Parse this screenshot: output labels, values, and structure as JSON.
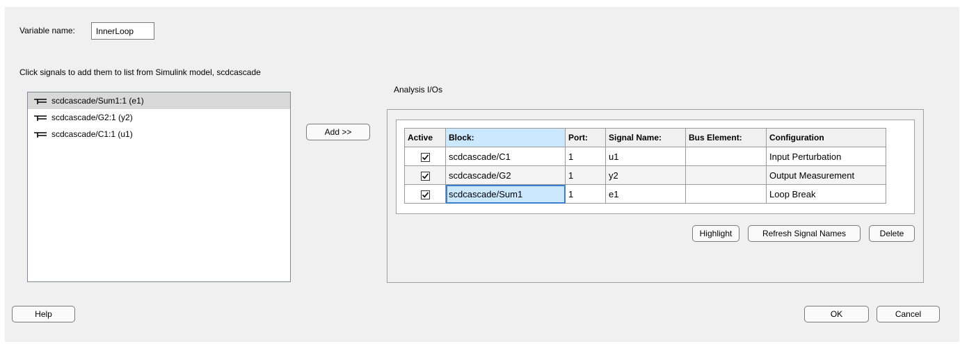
{
  "variable": {
    "label": "Variable name:",
    "value": "InnerLoop"
  },
  "instructions": "Click signals to add them to list from Simulink model, scdcascade",
  "signal_list": [
    {
      "label": "scdcascade/Sum1:1 (e1)",
      "icon": "signal-icon",
      "selected": true
    },
    {
      "label": "scdcascade/G2:1 (y2)",
      "icon": "signal-icon",
      "selected": false
    },
    {
      "label": "scdcascade/C1:1 (u1)",
      "icon": "signal-icon",
      "selected": false
    }
  ],
  "add_button": "Add >>",
  "analysis": {
    "title": "Analysis I/Os",
    "columns": [
      "Active",
      "Block:",
      "Port:",
      "Signal Name:",
      "Bus Element:",
      "Configuration"
    ],
    "rows": [
      {
        "active": true,
        "block": "scdcascade/C1",
        "port": "1",
        "signal": "u1",
        "bus": "",
        "config": "Input Perturbation"
      },
      {
        "active": true,
        "block": "scdcascade/G2",
        "port": "1",
        "signal": "y2",
        "bus": "",
        "config": "Output Measurement"
      },
      {
        "active": true,
        "block": "scdcascade/Sum1",
        "port": "1",
        "signal": "e1",
        "bus": "",
        "config": "Loop Break"
      }
    ],
    "buttons": {
      "highlight": "Highlight",
      "refresh": "Refresh Signal Names",
      "delete": "Delete"
    }
  },
  "footer": {
    "help": "Help",
    "ok": "OK",
    "cancel": "Cancel"
  },
  "colors": {
    "selection": "#cce8ff",
    "selected_item": "#d9d9d9",
    "dialog_bg": "#f0f0f0"
  }
}
